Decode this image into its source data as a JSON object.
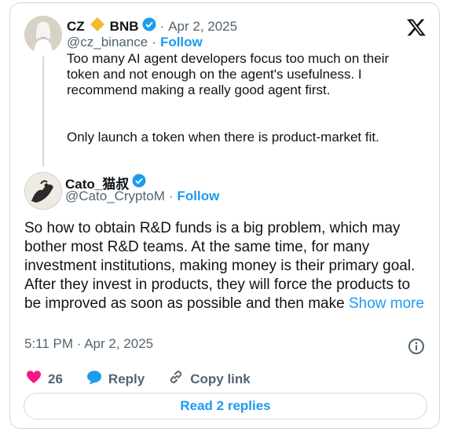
{
  "quoted": {
    "display_name": "CZ",
    "display_name_suffix": "BNB",
    "date": "Apr 2, 2025",
    "handle": "@cz_binance",
    "follow_label": "Follow",
    "text_p1": "Too many AI agent developers focus too much on their token and not enough on the agent's usefulness. I recommend making a really good agent first.",
    "text_p2": "Only launch a token when there is product-market fit."
  },
  "reply": {
    "display_name": "Cato_猫叔",
    "handle": "@Cato_CryptoM",
    "follow_label": "Follow",
    "text": "So how to obtain R&D funds is a big problem, which may bother most R&D teams. At the same time, for many investment institutions, making money is their primary goal. After they invest in products, they will force the products to be improved as soon as possible and then make",
    "show_more_label": "Show more",
    "timestamp": "5:11 PM · Apr 2, 2025"
  },
  "actions": {
    "like_count": "26",
    "reply_label": "Reply",
    "copy_link_label": "Copy link",
    "read_replies_label": "Read 2 replies"
  },
  "colors": {
    "accent": "#1d9bf0",
    "heart": "#f91880",
    "muted": "#536471",
    "bnb": "#f3ba2f"
  },
  "icons": [
    "x-logo-icon",
    "verified-badge-icon",
    "bnb-diamond-icon",
    "info-icon",
    "heart-icon",
    "reply-bubble-icon",
    "link-icon"
  ]
}
